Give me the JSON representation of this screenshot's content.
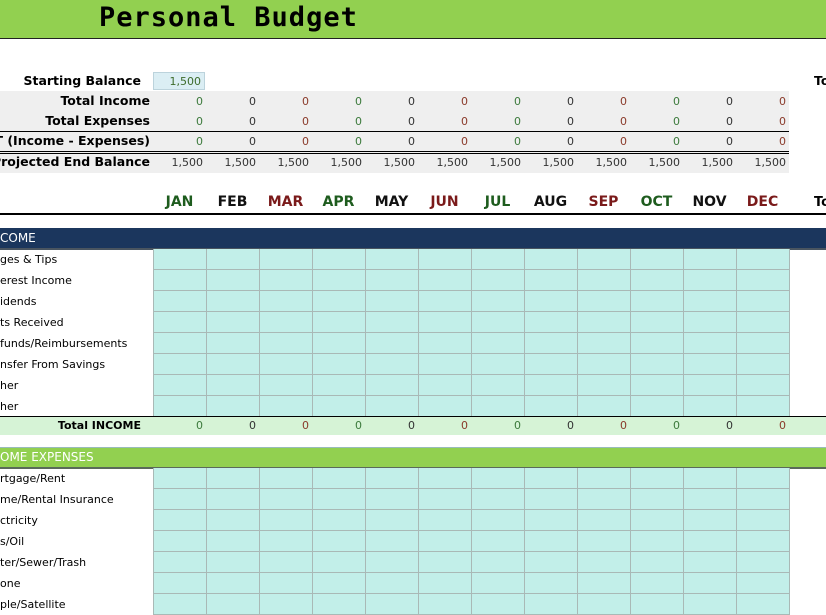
{
  "title": "Personal Budget",
  "summary": {
    "starting_balance_label": "Starting Balance",
    "starting_balance_value": "1,500",
    "total_col_header": "To",
    "rows": [
      {
        "label": "Total Income",
        "values": [
          "0",
          "0",
          "0",
          "0",
          "0",
          "0",
          "0",
          "0",
          "0",
          "0",
          "0",
          "0"
        ]
      },
      {
        "label": "Total Expenses",
        "values": [
          "0",
          "0",
          "0",
          "0",
          "0",
          "0",
          "0",
          "0",
          "0",
          "0",
          "0",
          "0"
        ]
      },
      {
        "label": "NET (Income - Expenses)",
        "values": [
          "0",
          "0",
          "0",
          "0",
          "0",
          "0",
          "0",
          "0",
          "0",
          "0",
          "0",
          "0"
        ]
      },
      {
        "label": "Projected End Balance",
        "values": [
          "1,500",
          "1,500",
          "1,500",
          "1,500",
          "1,500",
          "1,500",
          "1,500",
          "1,500",
          "1,500",
          "1,500",
          "1,500",
          "1,500"
        ]
      }
    ]
  },
  "months": [
    {
      "label": "JAN",
      "color": "green"
    },
    {
      "label": "FEB",
      "color": "dark"
    },
    {
      "label": "MAR",
      "color": "red"
    },
    {
      "label": "APR",
      "color": "green"
    },
    {
      "label": "MAY",
      "color": "dark"
    },
    {
      "label": "JUN",
      "color": "red"
    },
    {
      "label": "JUL",
      "color": "green"
    },
    {
      "label": "AUG",
      "color": "dark"
    },
    {
      "label": "SEP",
      "color": "red"
    },
    {
      "label": "OCT",
      "color": "green"
    },
    {
      "label": "NOV",
      "color": "dark"
    },
    {
      "label": "DEC",
      "color": "red"
    }
  ],
  "month_total_header": "To",
  "income": {
    "header": "COME",
    "items": [
      "ges & Tips",
      "erest Income",
      "idends",
      "ts Received",
      "funds/Reimbursements",
      "nsfer From Savings",
      "her",
      "her"
    ],
    "total_label": "Total INCOME",
    "total_values": [
      "0",
      "0",
      "0",
      "0",
      "0",
      "0",
      "0",
      "0",
      "0",
      "0",
      "0",
      "0"
    ]
  },
  "home_expenses": {
    "header": "OME EXPENSES",
    "items": [
      "rtgage/Rent",
      "me/Rental Insurance",
      "ctricity",
      "s/Oil",
      "ter/Sewer/Trash",
      "one",
      "ple/Satellite"
    ]
  }
}
